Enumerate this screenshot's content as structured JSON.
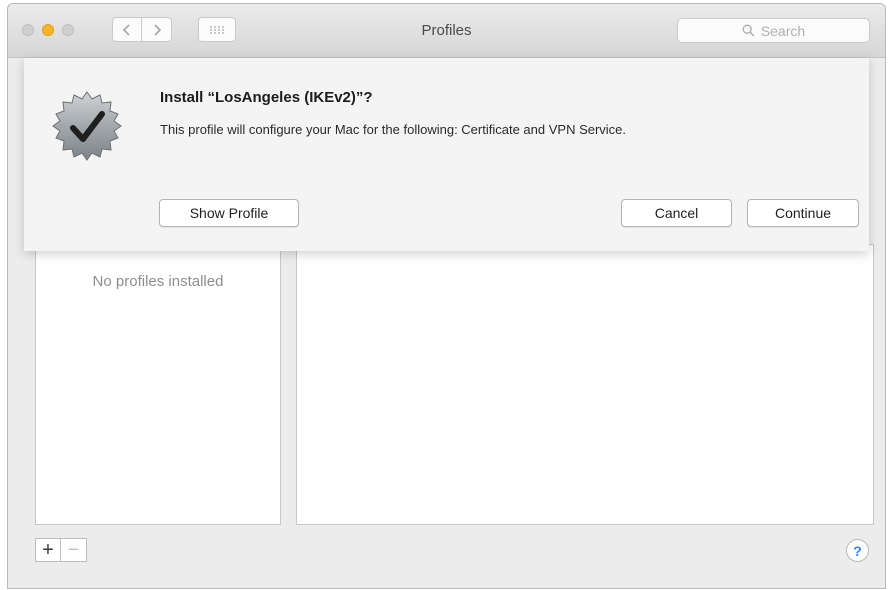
{
  "window": {
    "title": "Profiles",
    "search_placeholder": "Search"
  },
  "icons": {
    "close": "close-icon",
    "minimize": "minimize-icon",
    "zoom": "zoom-icon",
    "back": "chevron-left-icon",
    "forward": "chevron-right-icon",
    "show_all": "grid-icon",
    "search": "search-icon",
    "badge": "verified-badge-icon"
  },
  "colors": {
    "minimize": "#f6b625",
    "help": "#2f7ff5"
  },
  "sheet": {
    "title": "Install “LosAngeles (IKEv2)”?",
    "message": "This profile will configure your Mac for the following: Certificate and VPN Service.",
    "show_profile_label": "Show Profile",
    "cancel_label": "Cancel",
    "continue_label": "Continue"
  },
  "content": {
    "empty_list_text": "No profiles installed",
    "add_label": "+",
    "remove_label": "−",
    "help_label": "?"
  }
}
